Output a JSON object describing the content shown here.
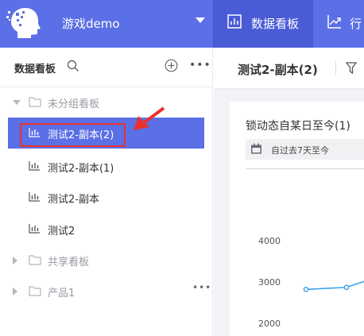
{
  "topbar": {
    "app_name": "游戏demo",
    "nav": [
      {
        "label": "数据看板",
        "active": true
      },
      {
        "label": "行"
      }
    ],
    "colors": {
      "bar": "#5b6fe6",
      "active": "#4a5bd6"
    }
  },
  "sidebar": {
    "title": "数据看板",
    "tree": [
      {
        "type": "group",
        "label": "未分组看板",
        "expanded": true
      },
      {
        "type": "board",
        "label": "测试2-副本(2)",
        "selected": true
      },
      {
        "type": "board",
        "label": "测试2-副本(1)"
      },
      {
        "type": "board",
        "label": "测试2-副本"
      },
      {
        "type": "board",
        "label": "测试2"
      },
      {
        "type": "group",
        "label": "共享看板",
        "expanded": false
      },
      {
        "type": "group",
        "label": "产品1",
        "expanded": false
      }
    ],
    "more_glyph": "•••"
  },
  "main": {
    "title": "测试2-副本(2)",
    "card": {
      "title": "锁动态自某日至今(1)",
      "date_range": "自过去7天至今"
    }
  },
  "chart_data": {
    "type": "line",
    "y_ticks": [
      "4000",
      "3000",
      "2000"
    ],
    "series": [
      {
        "values": [
          2820,
          2870,
          3200
        ]
      }
    ],
    "ylim": [
      2000,
      4000
    ],
    "line_color": "#3aa0e8"
  }
}
